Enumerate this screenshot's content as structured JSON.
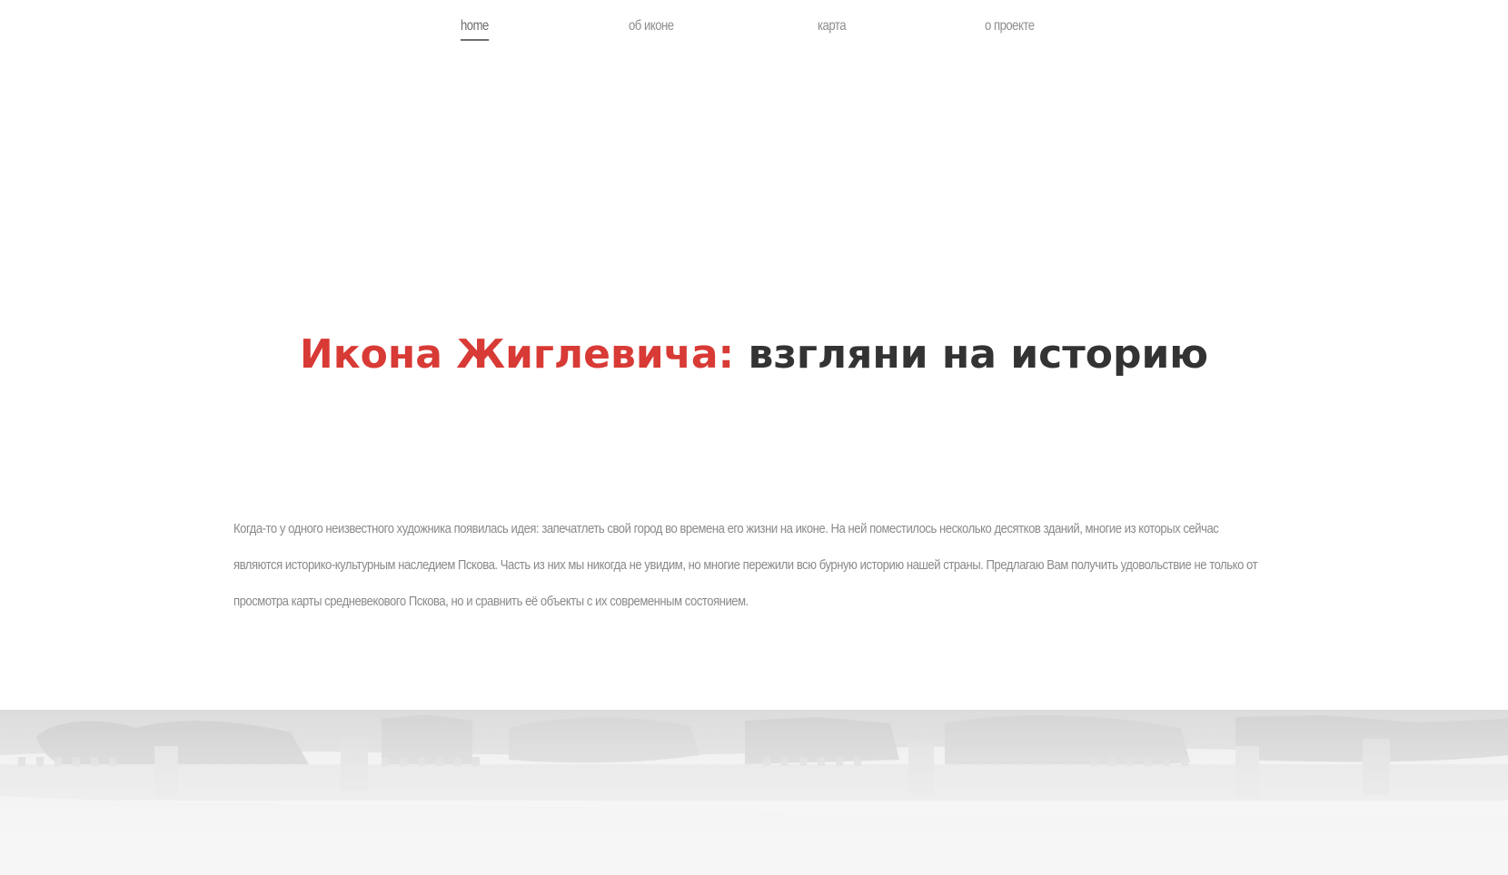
{
  "nav": {
    "items": [
      {
        "label": "home",
        "active": true
      },
      {
        "label": "об иконе",
        "active": false
      },
      {
        "label": "карта",
        "active": false
      },
      {
        "label": "о проекте",
        "active": false
      }
    ]
  },
  "hero": {
    "title_highlight": "Икона Жиглевича:",
    "title_rest": "взгляни на историю"
  },
  "intro": {
    "text": "Когда-то у одного неизвестного художника появилась идея: запечатлеть свой город во времена его жизни на иконе. На ней поместилось несколько десятков зданий, многие из которых сейчас являются историко-культурным наследием Пскова. Часть из них мы никогда не увидим, но многие пережили всю бурную историю нашей страны. Предлагаю Вам получить удовольствие не только от просмотра карты средневекового Пскова, но и сравнить её объекты с их современным состоянием."
  },
  "colors": {
    "accent": "#d83a35",
    "title_dark": "#333333",
    "nav_text": "#8e8e8e",
    "body_text": "#8a8a8a"
  }
}
